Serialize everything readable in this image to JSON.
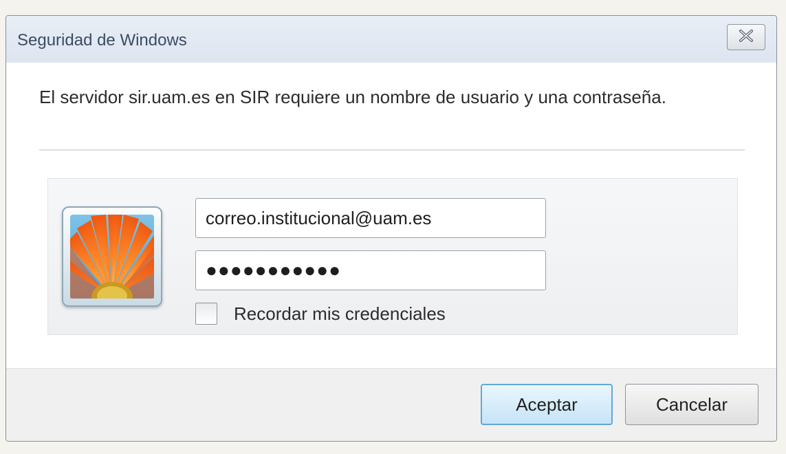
{
  "dialog": {
    "title": "Seguridad de Windows",
    "close_icon": "close-icon",
    "message": "El servidor sir.uam.es en SIR requiere un nombre de usuario y una contraseña.",
    "credentials": {
      "user_icon": "flower-user-tile-icon",
      "username_value": "correo.institucional@uam.es",
      "password_value": "●●●●●●●●●●●",
      "remember_label": "Recordar mis credenciales",
      "remember_checked": false
    },
    "buttons": {
      "ok_label": "Aceptar",
      "cancel_label": "Cancelar"
    },
    "colors": {
      "accent": "#5fa9d6",
      "title_text": "#3b4c63"
    }
  }
}
